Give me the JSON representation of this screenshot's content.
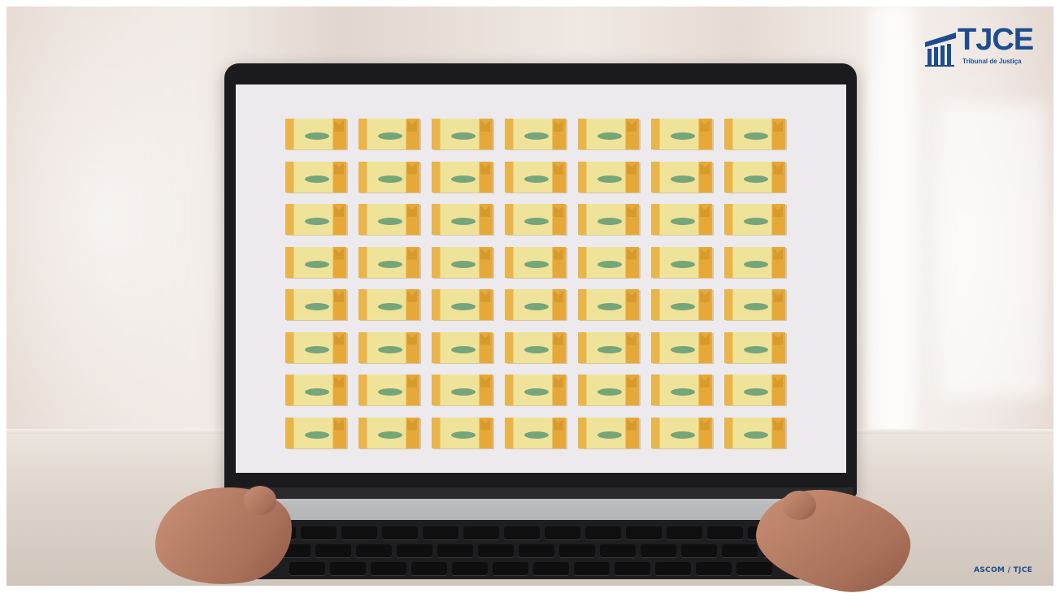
{
  "logo": {
    "word": "TJCE",
    "subtitle": "Tribunal de Justiça",
    "brand_color": "#1e4c8f"
  },
  "credit": "ASCOM / TJCE",
  "screen": {
    "tile_rows": 8,
    "tile_columns": 7,
    "tile_colors": {
      "left_band": "#e9b54a",
      "body": "#efe39a",
      "right_band": "#e7a83a",
      "seal": "#5f9a73"
    }
  },
  "scene": {
    "subject": "laptop-on-table",
    "background_color": "#e8ddd6",
    "laptop_color": "#1b1b1d"
  }
}
